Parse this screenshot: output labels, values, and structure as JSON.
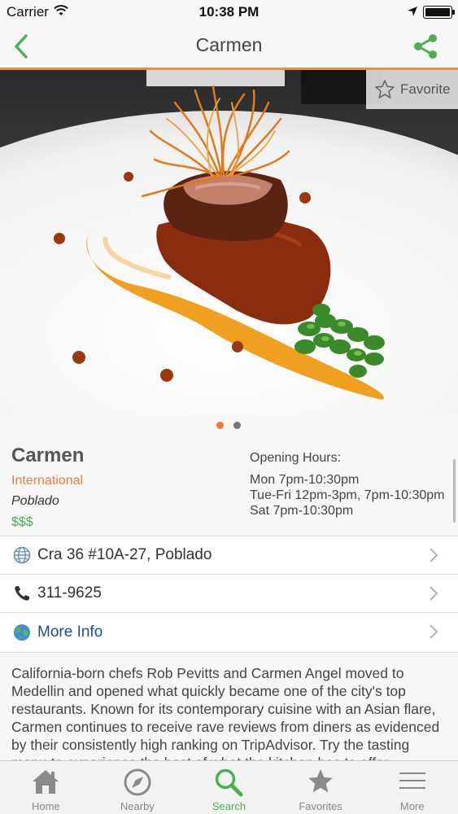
{
  "status_bar": {
    "carrier": "Carrier",
    "time": "10:38 PM"
  },
  "nav": {
    "title": "Carmen"
  },
  "favorite": {
    "label": "Favorite"
  },
  "restaurant": {
    "name": "Carmen",
    "cuisine": "International",
    "neighborhood": "Poblado",
    "price": "$$$",
    "hours_title": "Opening Hours:",
    "hours": [
      "Mon 7pm-10:30pm",
      "Tue-Fri 12pm-3pm, 7pm-10:30pm",
      "Sat 7pm-10:30pm"
    ]
  },
  "rows": {
    "address": "Cra 36 #10A-27, Poblado",
    "phone": "311-9625",
    "more_info": "More Info"
  },
  "description": "California-born chefs Rob Pevitts and Carmen Angel moved to Medellin and opened what quickly became one of the city's top restaurants. Known for its contemporary cuisine with an Asian flare, Carmen continues to receive rave reviews from diners as evidenced by their consistently high ranking on TripAdvisor. Try the tasting menu to experience the best of what the kitchen has to offer.",
  "tabs": [
    {
      "label": "Home",
      "icon": "home-icon",
      "active": false
    },
    {
      "label": "Nearby",
      "icon": "compass-icon",
      "active": false
    },
    {
      "label": "Search",
      "icon": "search-icon",
      "active": true
    },
    {
      "label": "Favorites",
      "icon": "star-icon",
      "active": false
    },
    {
      "label": "More",
      "icon": "menu-icon",
      "active": false
    }
  ],
  "colors": {
    "accent": "#f07a3c",
    "green": "#4caf50",
    "link": "#1c4f8a"
  },
  "pager": {
    "pages": 2,
    "current": 1
  }
}
